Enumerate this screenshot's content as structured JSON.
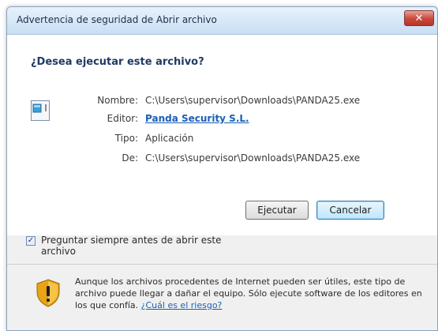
{
  "window": {
    "title": "Advertencia de seguridad de Abrir archivo",
    "close_symbol": "✕"
  },
  "dialog": {
    "question": "¿Desea ejecutar este archivo?",
    "file_icon": "executable-file-icon",
    "fields": [
      {
        "label": "Nombre:",
        "value": "C:\\Users\\supervisor\\Downloads\\PANDA25.exe"
      },
      {
        "label": "Editor:",
        "value": "Panda Security S.L."
      },
      {
        "label": "Tipo:",
        "value": "Aplicación"
      },
      {
        "label": "De:",
        "value": "C:\\Users\\supervisor\\Downloads\\PANDA25.exe"
      }
    ],
    "run_button": "Ejecutar",
    "cancel_button": "Cancelar",
    "checkbox": {
      "checked": true,
      "check_mark": "✓",
      "label": "Preguntar siempre antes de abrir este archivo"
    }
  },
  "warning": {
    "icon": "shield-warning-icon",
    "text": "Aunque los archivos procedentes de Internet pueden ser útiles, este tipo de archivo puede llegar a dañar el equipo. Sólo ejecute software de los editores en los que confía.",
    "link": "¿Cuál es el riesgo?"
  },
  "colors": {
    "title_gradient_top": "#e7f1fb",
    "close_button": "#c8463a",
    "link": "#1a5fb4",
    "warning_shield": "#e8a317"
  }
}
